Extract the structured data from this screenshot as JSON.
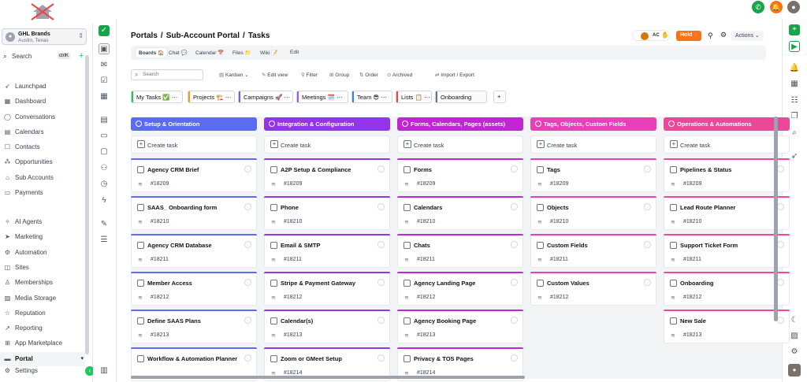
{
  "account": {
    "name": "GHL Brands",
    "location": "Austin, Texas"
  },
  "search": {
    "label": "Search",
    "shortcut": "ctrlK"
  },
  "nav": [
    {
      "label": "Launchpad",
      "icon": "rocket-icon"
    },
    {
      "label": "Dashboard",
      "icon": "dashboard-icon"
    },
    {
      "label": "Conversations",
      "icon": "chat-icon"
    },
    {
      "label": "Calendars",
      "icon": "calendar-icon"
    },
    {
      "label": "Contacts",
      "icon": "contacts-icon"
    },
    {
      "label": "Opportunities",
      "icon": "opportunities-icon"
    },
    {
      "label": "Sub Accounts",
      "icon": "sub-accounts-icon"
    },
    {
      "label": "Payments",
      "icon": "payments-icon"
    },
    {
      "label": "AI Agents",
      "icon": "ai-agents-icon"
    },
    {
      "label": "Marketing",
      "icon": "marketing-icon"
    },
    {
      "label": "Automation",
      "icon": "automation-icon"
    },
    {
      "label": "Sites",
      "icon": "sites-icon"
    },
    {
      "label": "Memberships",
      "icon": "memberships-icon"
    },
    {
      "label": "Media Storage",
      "icon": "media-icon"
    },
    {
      "label": "Reputation",
      "icon": "star-icon"
    },
    {
      "label": "Reporting",
      "icon": "reporting-icon"
    },
    {
      "label": "App Marketplace",
      "icon": "marketplace-icon"
    },
    {
      "label": "Portal",
      "icon": "portal-icon",
      "active": true
    }
  ],
  "settings": {
    "label": "Settings"
  },
  "breadcrumb": [
    "Portals",
    "/",
    "Sub-Account Portal",
    "/",
    "Tasks"
  ],
  "header": {
    "initials": "AC",
    "hold": "Hold",
    "actions": "Actions"
  },
  "subtabs": [
    {
      "label": "Boards 🏠",
      "active": true
    },
    {
      "label": "Chat 💬"
    },
    {
      "label": "Calendar 📅"
    },
    {
      "label": "Files 📁"
    },
    {
      "label": "Wiki 📝"
    },
    {
      "label": "Edit"
    }
  ],
  "toolbar": {
    "search_placeholder": "Search",
    "items": [
      "Kanban",
      "Edit view",
      "Filter",
      "Group",
      "Order",
      "Archived",
      "Import / Export"
    ]
  },
  "views": [
    {
      "label": "My Tasks ✅",
      "color": "#22c55e"
    },
    {
      "label": "Projects 🏗️",
      "color": "#f59e0b"
    },
    {
      "label": "Campaigns 🚀",
      "color": "#6366f1"
    },
    {
      "label": "Meetings 🗓️",
      "color": "#a855f7"
    },
    {
      "label": "Team 😎",
      "color": "#3b82f6"
    },
    {
      "label": "Lists 📋",
      "color": "#ef4444"
    },
    {
      "label": "Onboarding",
      "color": "#6b7280",
      "active": true
    }
  ],
  "create_label": "Create task",
  "columns": [
    {
      "title": "Setup & Orientation",
      "color": "#5b6cf2",
      "cards": [
        {
          "name": "Agency CRM Brief",
          "id": "#18209"
        },
        {
          "name": "SAAS_ Onboarding form",
          "id": "#18210"
        },
        {
          "name": "Agency CRM Database",
          "id": "#18211"
        },
        {
          "name": "Member Access",
          "id": "#18212"
        },
        {
          "name": "Define SAAS Plans",
          "id": "#18213"
        },
        {
          "name": "Workflow & Automation Planner",
          "id": ""
        }
      ]
    },
    {
      "title": "Integration & Configuration",
      "color": "#9333ea",
      "cards": [
        {
          "name": "A2P Setup & Compliance",
          "id": "#18209"
        },
        {
          "name": "Phone",
          "id": "#18210"
        },
        {
          "name": "Email & SMTP",
          "id": "#18211"
        },
        {
          "name": "Stripe & Payment Gateway",
          "id": "#18212"
        },
        {
          "name": "Calendar(s)",
          "id": "#18213"
        },
        {
          "name": "Zoom or GMeet Setup",
          "id": "#18214"
        }
      ]
    },
    {
      "title": "Forms, Calendars, Pages (assets)",
      "color": "#c026d3",
      "cards": [
        {
          "name": "Forms",
          "id": "#18209"
        },
        {
          "name": "Calendars",
          "id": "#18210"
        },
        {
          "name": "Chats",
          "id": "#18211"
        },
        {
          "name": "Agency Landing Page",
          "id": "#18212"
        },
        {
          "name": "Agency Booking Page",
          "id": "#18213"
        },
        {
          "name": "Privacy & TOS Pages",
          "id": "#18214"
        }
      ]
    },
    {
      "title": "Tags, Objects, Custom Fields",
      "color": "#e93fb8",
      "cards": [
        {
          "name": "Tags",
          "id": "#18209"
        },
        {
          "name": "Objects",
          "id": "#18210"
        },
        {
          "name": "Custom Fields",
          "id": "#18211"
        },
        {
          "name": "Custom Values",
          "id": "#18212"
        }
      ]
    },
    {
      "title": "Operations & Automations",
      "color": "#ec4899",
      "cards": [
        {
          "name": "Pipelines & Status",
          "id": "#18209"
        },
        {
          "name": "Lead Route Planner",
          "id": "#18210"
        },
        {
          "name": "Support Ticket Form",
          "id": "#18211"
        },
        {
          "name": "Onboarding",
          "id": "#18212"
        },
        {
          "name": "New Sale",
          "id": "#18213"
        }
      ]
    }
  ]
}
